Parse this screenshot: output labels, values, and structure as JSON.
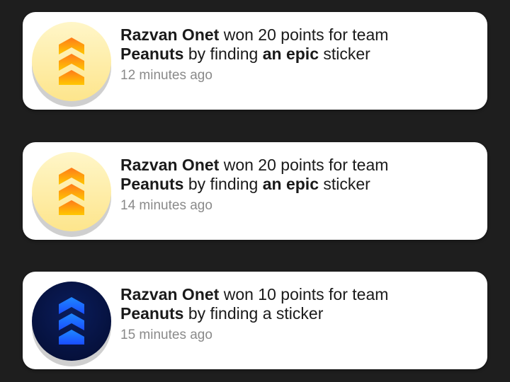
{
  "notifications": [
    {
      "user": "Razvan Onet",
      "action_text": " won 20 points for team",
      "team": "Peanuts",
      "middle_text": " by finding ",
      "sticker_rarity": "an epic",
      "end_text": " sticker",
      "time": "12 minutes ago",
      "badge_icon": "chevron-rank-icon",
      "badge_style": "epic",
      "badge_colors": {
        "bg_top": "#fff6c8",
        "bg_bottom": "#fde58c",
        "chev_top": "#ff7a1a",
        "chev_bottom": "#ffc800"
      }
    },
    {
      "user": "Razvan Onet",
      "action_text": " won 20 points for team",
      "team": "Peanuts",
      "middle_text": " by finding ",
      "sticker_rarity": "an epic",
      "end_text": " sticker",
      "time": "14 minutes ago",
      "badge_icon": "chevron-rank-icon",
      "badge_style": "epic",
      "badge_colors": {
        "bg_top": "#fff6c8",
        "bg_bottom": "#fde58c",
        "chev_top": "#ff7a1a",
        "chev_bottom": "#ffc800"
      }
    },
    {
      "user": "Razvan Onet",
      "action_text": " won 10 points for team",
      "team": "Peanuts",
      "middle_text": " by finding a sticker",
      "sticker_rarity": "",
      "end_text": "",
      "time": "15 minutes ago",
      "badge_icon": "chevron-rank-icon",
      "badge_style": "common",
      "badge_colors": {
        "bg_top": "#0b1d5c",
        "bg_bottom": "#05103a",
        "chev_top": "#1e88ff",
        "chev_bottom": "#1a4dff"
      }
    }
  ]
}
